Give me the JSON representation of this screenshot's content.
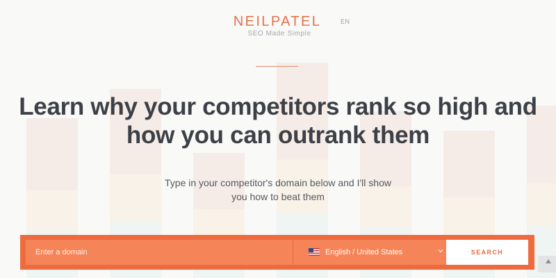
{
  "header": {
    "logo_text": "NEILPATEL",
    "tagline": "SEO Made Simple",
    "language": "EN"
  },
  "hero": {
    "headline_line1": "Learn why your competitors rank so high and",
    "headline_line2": "how you can outrank them",
    "subtitle_line1": "Type in your competitor's domain below and I'll show",
    "subtitle_line2": "you how to beat them"
  },
  "search": {
    "domain_placeholder": "Enter a domain",
    "locale_selected": "English / United States",
    "locale_flag_icon": "us-flag-icon",
    "button_label": "SEARCH"
  },
  "colors": {
    "brand_orange": "#ee6a3f",
    "field_orange": "#f58458",
    "logo_orange": "#e6714a",
    "headline": "#3d4046"
  }
}
